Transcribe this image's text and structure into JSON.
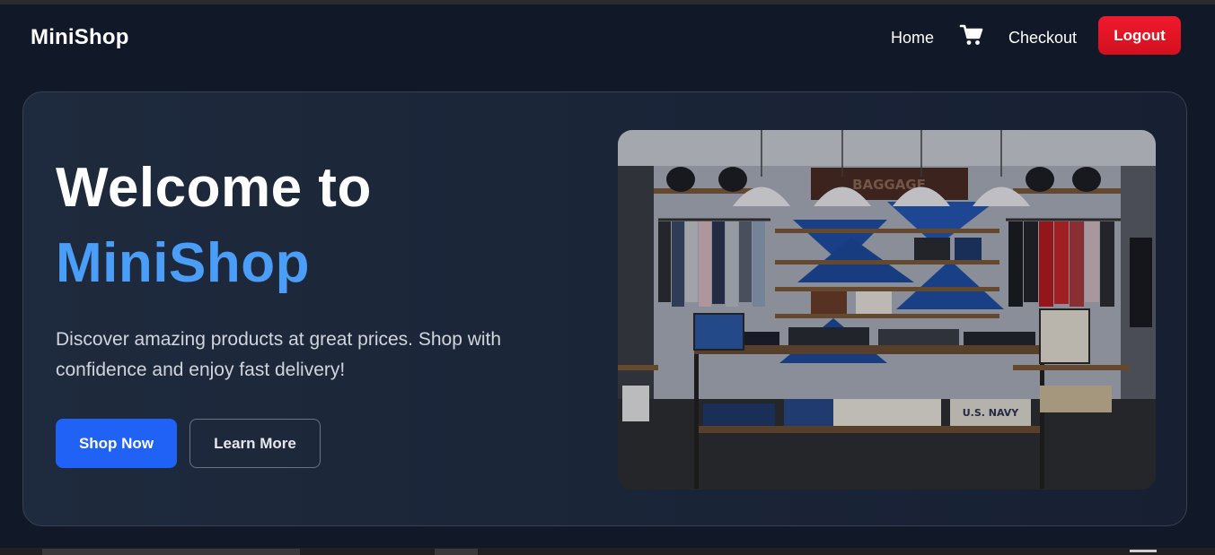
{
  "navbar": {
    "brand": "MiniShop",
    "links": {
      "home": "Home",
      "checkout": "Checkout"
    },
    "cart_icon": "cart-icon",
    "logout_label": "Logout"
  },
  "hero": {
    "title_line1": "Welcome to",
    "title_line2": "MiniShop",
    "description": "Discover amazing products at great prices. Shop with confidence and enjoy fast delivery!",
    "primary_button": "Shop Now",
    "secondary_button": "Learn More",
    "image": "store-interior"
  },
  "colors": {
    "background": "#111827",
    "accent_blue": "#4a9ef8",
    "primary_button": "#1f62f5",
    "logout_red": "#ef1a2e"
  }
}
